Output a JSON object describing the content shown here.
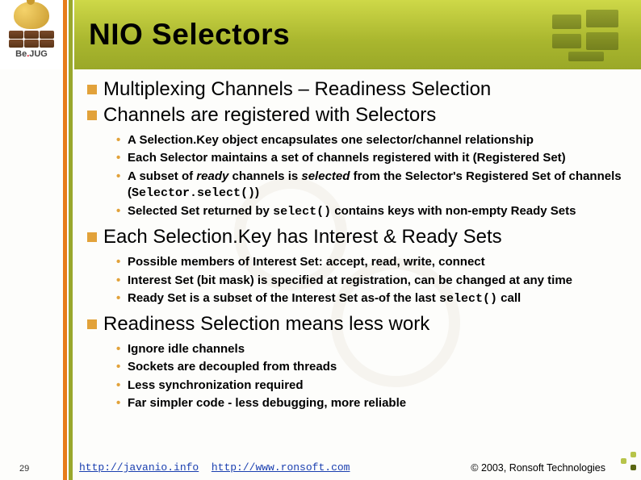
{
  "logo": {
    "text_pre": "Be",
    "text_dot": ".",
    "text_post": "JUG"
  },
  "title": "NIO Selectors",
  "sections": [
    {
      "heading": "Multiplexing Channels – Readiness Selection",
      "bullets": []
    },
    {
      "heading": "Channels are registered with Selectors",
      "bullets": [
        {
          "text": "A Selection.Key object encapsulates one selector/channel relationship"
        },
        {
          "text": "Each Selector maintains a set of channels registered with it (Registered Set)"
        },
        {
          "html": "A subset of <span class='ital'>ready</span> channels is <span class='ital'>selected</span> from the Selector's Registered Set of channels (<span class='mono'>Selector.select()</span>)"
        },
        {
          "html": "Selected Set returned by <span class='mono'>select()</span> contains keys with non-empty Ready Sets"
        }
      ]
    },
    {
      "heading": "Each Selection.Key has Interest & Ready Sets",
      "bullets": [
        {
          "text": "Possible members of Interest Set: accept, read, write, connect"
        },
        {
          "text": "Interest Set (bit mask) is specified at registration, can be changed at any time"
        },
        {
          "html": "Ready Set is a subset of the Interest Set as-of the last <span class='mono'>select()</span> call"
        }
      ]
    },
    {
      "heading": "Readiness Selection means less work",
      "bullets": [
        {
          "text": "Ignore idle channels"
        },
        {
          "text": "Sockets are decoupled from threads"
        },
        {
          "text": "Less synchronization required"
        },
        {
          "text": "Far simpler code - less debugging, more reliable"
        }
      ]
    }
  ],
  "footer": {
    "page": "29",
    "link1": "http://javanio.info",
    "link2": "http://www.ronsoft.com",
    "copyright": "© 2003, Ronsoft Technologies"
  }
}
